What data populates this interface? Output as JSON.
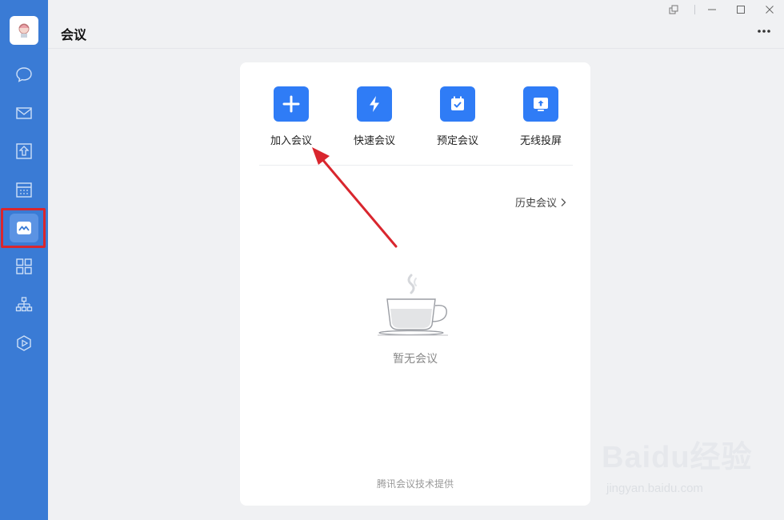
{
  "header": {
    "title": "会议"
  },
  "sidebar": {
    "items": [
      {
        "icon": "chat-icon"
      },
      {
        "icon": "mail-icon"
      },
      {
        "icon": "workspace-icon"
      },
      {
        "icon": "calendar-icon"
      },
      {
        "icon": "meeting-icon",
        "active": true
      },
      {
        "icon": "apps-grid-icon"
      },
      {
        "icon": "org-chart-icon"
      },
      {
        "icon": "video-play-icon"
      }
    ]
  },
  "window_controls": [
    "pin-icon",
    "minimize-icon",
    "maximize-icon",
    "close-icon"
  ],
  "actions": [
    {
      "label": "加入会议",
      "icon": "plus-icon"
    },
    {
      "label": "快速会议",
      "icon": "lightning-icon"
    },
    {
      "label": "预定会议",
      "icon": "calendar-check-icon"
    },
    {
      "label": "无线投屏",
      "icon": "screen-share-icon"
    }
  ],
  "history_label": "历史会议",
  "empty_text": "暂无会议",
  "provider_text": "腾讯会议技术提供",
  "watermark": {
    "brand": "Baidu经验",
    "url": "jingyan.baidu.com"
  },
  "colors": {
    "sidebar": "#3a7bd5",
    "accent": "#2f7cf6",
    "highlight_frame": "#d9262e",
    "arrow": "#d9262e"
  }
}
